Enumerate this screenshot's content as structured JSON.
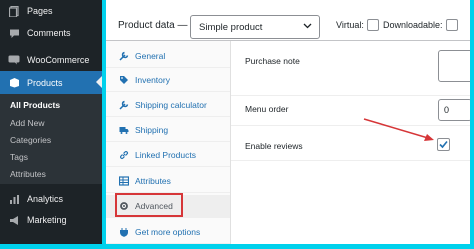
{
  "sidebar": {
    "items": [
      {
        "label": "Pages",
        "icon": "pages-icon"
      },
      {
        "label": "Comments",
        "icon": "comments-icon"
      },
      {
        "label": "WooCommerce",
        "icon": "woocommerce-icon"
      },
      {
        "label": "Products",
        "icon": "products-icon"
      },
      {
        "label": "Analytics",
        "icon": "analytics-icon"
      },
      {
        "label": "Marketing",
        "icon": "marketing-icon"
      }
    ],
    "submenu": [
      {
        "label": "All Products"
      },
      {
        "label": "Add New"
      },
      {
        "label": "Categories"
      },
      {
        "label": "Tags"
      },
      {
        "label": "Attributes"
      }
    ]
  },
  "product_data": {
    "label": "Product data —",
    "type_select": {
      "value": "Simple product"
    },
    "virtual_label": "Virtual:",
    "downloadable_label": "Downloadable:",
    "tabs": [
      {
        "label": "General",
        "icon": "wrench-icon"
      },
      {
        "label": "Inventory",
        "icon": "tag-icon"
      },
      {
        "label": "Shipping calculator",
        "icon": "wrench-icon"
      },
      {
        "label": "Shipping",
        "icon": "truck-icon"
      },
      {
        "label": "Linked Products",
        "icon": "link-icon"
      },
      {
        "label": "Attributes",
        "icon": "table-icon"
      },
      {
        "label": "Advanced",
        "icon": "gear-icon"
      },
      {
        "label": "Get more options",
        "icon": "plug-icon"
      }
    ],
    "fields": {
      "purchase_note": {
        "label": "Purchase note",
        "value": ""
      },
      "menu_order": {
        "label": "Menu order",
        "value": "0"
      },
      "enable_reviews": {
        "label": "Enable reviews",
        "checked": true
      }
    }
  },
  "colors": {
    "sidebar_bg": "#1d2327",
    "active_blue": "#2271b1",
    "highlight_red": "#d63638",
    "frame_cyan": "#00d1ec"
  }
}
